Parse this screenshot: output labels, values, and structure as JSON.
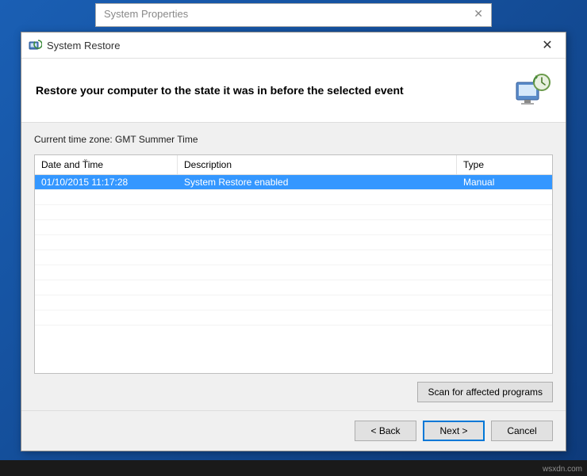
{
  "backgroundWindow": {
    "title": "System Properties"
  },
  "wizard": {
    "title": "System Restore",
    "heading": "Restore your computer to the state it was in before the selected event",
    "timezoneLabel": "Current time zone: GMT Summer Time",
    "table": {
      "headers": {
        "date": "Date and Time",
        "description": "Description",
        "type": "Type"
      },
      "rows": [
        {
          "date": "01/10/2015 11:17:28",
          "description": "System Restore enabled",
          "type": "Manual",
          "selected": true
        }
      ]
    },
    "scanButton": "Scan for affected programs",
    "footer": {
      "back": "< Back",
      "next": "Next >",
      "cancel": "Cancel"
    }
  },
  "watermark": "wsxdn.com"
}
